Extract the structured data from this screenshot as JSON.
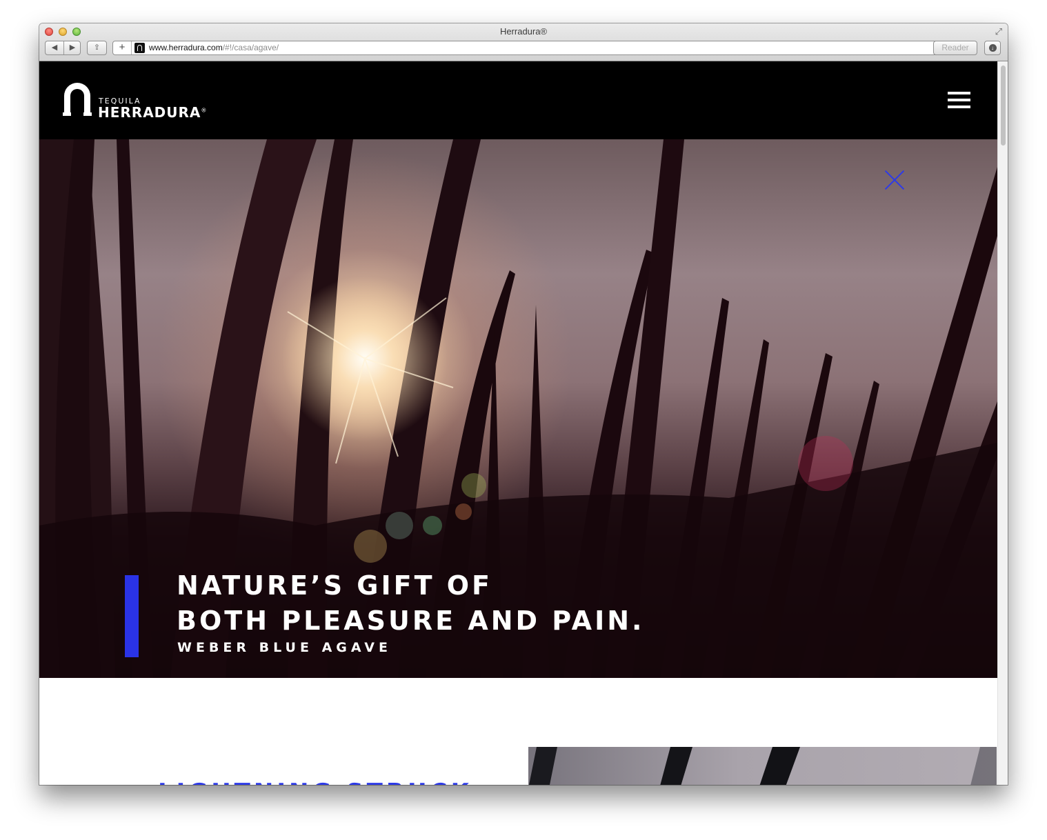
{
  "browser": {
    "window_title": "Herradura®",
    "fullscreen_glyph": "⤢",
    "back_glyph": "◀",
    "forward_glyph": "▶",
    "share_glyph": "⇪",
    "new_tab_glyph": "+",
    "url_host": "www.herradura.com",
    "url_path": "/#!/casa/agave/",
    "reload_glyph": "↻",
    "reader_label": "Reader",
    "download_glyph": "↓"
  },
  "site": {
    "logo_small": "TEQUILA",
    "logo_big": "HERRADURA",
    "logo_mark": "®"
  },
  "hero": {
    "title_line1": "NATURE’S GIFT OF",
    "title_line2": "BOTH PLEASURE AND PAIN.",
    "subtitle": "WEBER BLUE AGAVE",
    "accent_color": "#2a33e6"
  },
  "next_section": {
    "heading_partial": "LIGHTNING STRUCK"
  }
}
